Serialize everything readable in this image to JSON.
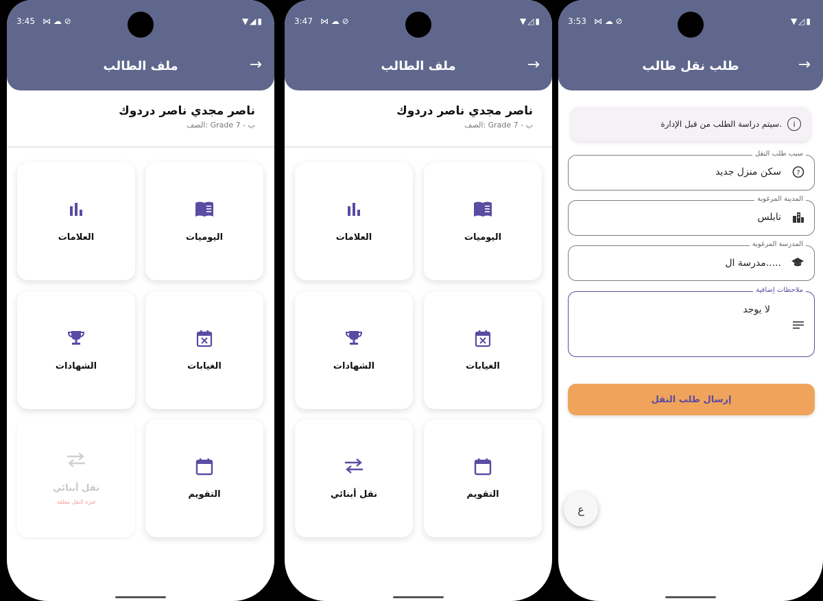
{
  "screens": [
    {
      "status": {
        "time": "3:45",
        "notif": "⋈ ☁ ⊘",
        "sys": "▼◢▮"
      },
      "title": "ملف الطالب",
      "student": {
        "name": "ناصر مجدي ناصر دردوك",
        "class": "الصف: Grade 7 - ب"
      },
      "tiles": [
        {
          "icon": "book-icon",
          "glyph": "▤",
          "label": "اليوميات"
        },
        {
          "icon": "bar-chart-icon",
          "glyph": "▮",
          "label": "العلامات"
        },
        {
          "icon": "calendar-x-icon",
          "glyph": "☒",
          "label": "الغيابات"
        },
        {
          "icon": "trophy-icon",
          "glyph": "♛",
          "label": "الشهادات"
        },
        {
          "icon": "calendar-icon",
          "glyph": "▭",
          "label": "التقويم"
        },
        {
          "icon": "swap-icon",
          "glyph": "⇄",
          "label": "نقل أبنائي",
          "sub": "فترة النقل مغلقة"
        }
      ]
    },
    {
      "status": {
        "time": "3:47",
        "notif": "⋈ ☁ ⊘",
        "sys": "▼◿▮"
      },
      "title": "ملف الطالب",
      "student": {
        "name": "ناصر مجدي ناصر دردوك",
        "class": "الصف: Grade 7 - ب"
      },
      "tiles": [
        {
          "icon": "book-icon",
          "glyph": "▤",
          "label": "اليوميات"
        },
        {
          "icon": "bar-chart-icon",
          "glyph": "▮",
          "label": "العلامات"
        },
        {
          "icon": "calendar-x-icon",
          "glyph": "☒",
          "label": "الغيابات"
        },
        {
          "icon": "trophy-icon",
          "glyph": "♛",
          "label": "الشهادات"
        },
        {
          "icon": "calendar-icon",
          "glyph": "▭",
          "label": "التقويم"
        },
        {
          "icon": "swap-icon",
          "glyph": "⇄",
          "label": "نقل أبنائي"
        }
      ]
    },
    {
      "status": {
        "time": "3:53",
        "notif": "⋈ ☁ ⊘",
        "sys": "▼◿▮"
      },
      "title": "طلب نقل طالب",
      "info": "سيتم دراسة الطلب من قبل الإدارة.",
      "fields": [
        {
          "label": "سبب طلب النقل",
          "value": "سكن منزل جديد",
          "icon": "help-circle-icon"
        },
        {
          "label": "المدينة المرغوبة",
          "value": "نابلس",
          "icon": "city-icon"
        },
        {
          "label": "المدرسة المرغوبة",
          "value": "مدرسة ال.....",
          "icon": "school-icon"
        },
        {
          "label": "ملاحظات إضافية",
          "value": "لا يوجد",
          "icon": "notes-icon"
        }
      ],
      "submit": "إرسال طلب النقل",
      "fab": "ع"
    }
  ],
  "colors": {
    "appbar": "#5f678c",
    "accent": "#5a4ba3",
    "submit": "#f0a35a"
  }
}
